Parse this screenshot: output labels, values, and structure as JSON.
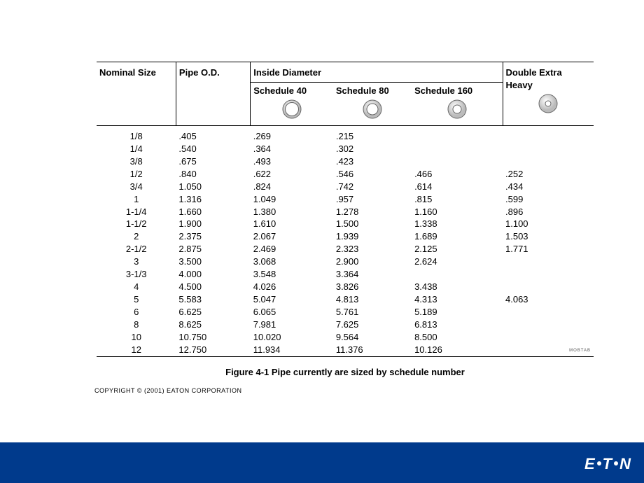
{
  "headers": {
    "nominal": "Nominal Size",
    "od": "Pipe O.D.",
    "id_group": "Inside Diameter",
    "s40": "Schedule 40",
    "s80": "Schedule 80",
    "s160": "Schedule 160",
    "deh": "Double Extra Heavy"
  },
  "rows": [
    {
      "nom": "1/8",
      "od": ".405",
      "s40": ".269",
      "s80": ".215",
      "s160": "",
      "deh": ""
    },
    {
      "nom": "1/4",
      "od": ".540",
      "s40": ".364",
      "s80": ".302",
      "s160": "",
      "deh": ""
    },
    {
      "nom": "3/8",
      "od": ".675",
      "s40": ".493",
      "s80": ".423",
      "s160": "",
      "deh": ""
    },
    {
      "nom": "1/2",
      "od": ".840",
      "s40": ".622",
      "s80": ".546",
      "s160": ".466",
      "deh": ".252"
    },
    {
      "nom": "3/4",
      "od": "1.050",
      "s40": ".824",
      "s80": ".742",
      "s160": ".614",
      "deh": ".434"
    },
    {
      "nom": "1",
      "od": "1.316",
      "s40": "1.049",
      "s80": ".957",
      "s160": ".815",
      "deh": ".599"
    },
    {
      "nom": "1-1/4",
      "od": "1.660",
      "s40": "1.380",
      "s80": "1.278",
      "s160": "1.160",
      "deh": ".896"
    },
    {
      "nom": "1-1/2",
      "od": "1.900",
      "s40": "1.610",
      "s80": "1.500",
      "s160": "1.338",
      "deh": "1.100"
    },
    {
      "nom": "2",
      "od": "2.375",
      "s40": "2.067",
      "s80": "1.939",
      "s160": "1.689",
      "deh": "1.503"
    },
    {
      "nom": "2-1/2",
      "od": "2.875",
      "s40": "2.469",
      "s80": "2.323",
      "s160": "2.125",
      "deh": "1.771"
    },
    {
      "nom": "3",
      "od": "3.500",
      "s40": "3.068",
      "s80": "2.900",
      "s160": "2.624",
      "deh": ""
    },
    {
      "nom": "3-1/3",
      "od": "4.000",
      "s40": "3.548",
      "s80": "3.364",
      "s160": "",
      "deh": ""
    },
    {
      "nom": "4",
      "od": "4.500",
      "s40": "4.026",
      "s80": "3.826",
      "s160": "3.438",
      "deh": ""
    },
    {
      "nom": "5",
      "od": "5.583",
      "s40": "5.047",
      "s80": "4.813",
      "s160": "4.313",
      "deh": "4.063"
    },
    {
      "nom": "6",
      "od": "6.625",
      "s40": "6.065",
      "s80": "5.761",
      "s160": "5.189",
      "deh": ""
    },
    {
      "nom": "8",
      "od": "8.625",
      "s40": "7.981",
      "s80": "7.625",
      "s160": "6.813",
      "deh": ""
    },
    {
      "nom": "10",
      "od": "10.750",
      "s40": "10.020",
      "s80": "9.564",
      "s160": "8.500",
      "deh": ""
    },
    {
      "nom": "12",
      "od": "12.750",
      "s40": "11.934",
      "s80": "11.376",
      "s160": "10.126",
      "deh": ""
    }
  ],
  "caption": "Figure 4-1    Pipe currently are sized by schedule number",
  "copyright": "COPYRIGHT  ©  (2001) EATON CORPORATION",
  "brand": "EATON",
  "tiny_mark": "MOBTAB"
}
